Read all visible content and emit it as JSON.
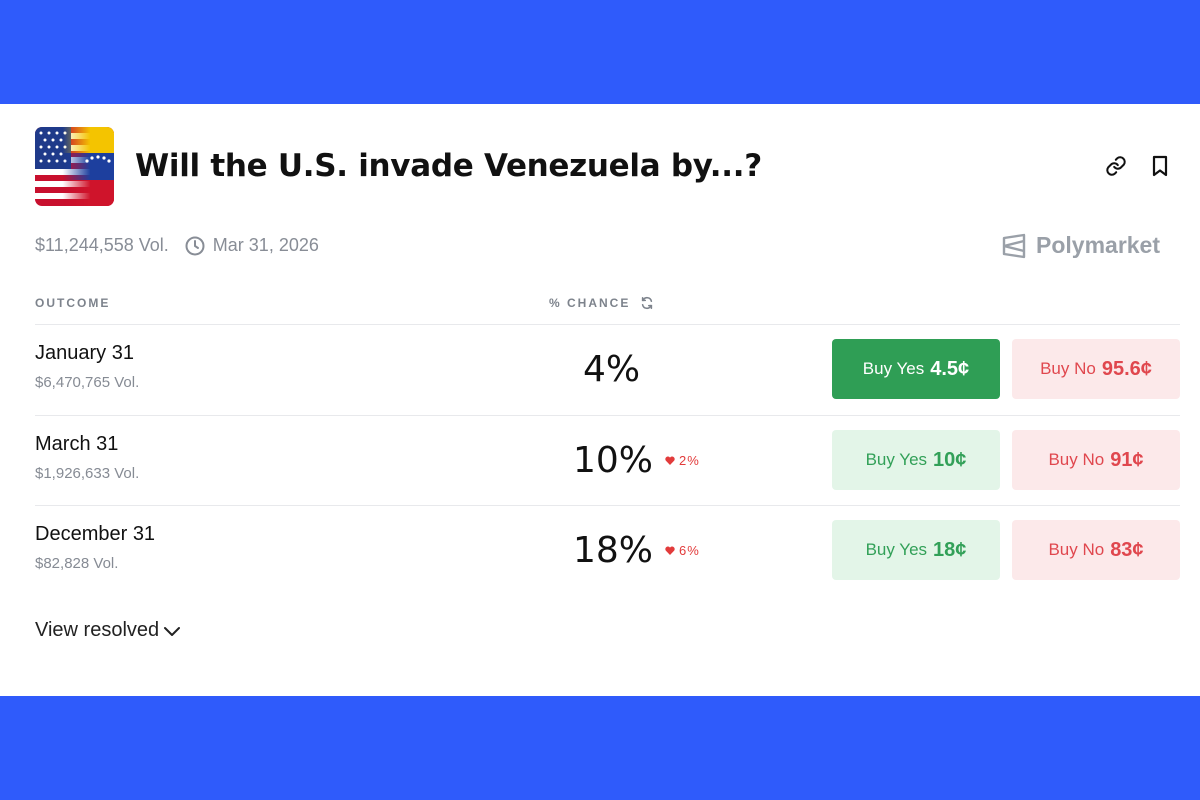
{
  "market": {
    "title": "Will the U.S. invade Venezuela by...?",
    "volume": "$11,244,558 Vol.",
    "end_date": "Mar 31, 2026",
    "brand": "Polymarket"
  },
  "columns": {
    "outcome": "OUTCOME",
    "chance": "% CHANCE"
  },
  "outcomes": [
    {
      "name": "January 31",
      "volume": "$6,470,765 Vol.",
      "chance": "4%",
      "change": "",
      "yes_label": "Buy Yes",
      "yes_price": "4.5¢",
      "no_label": "Buy No",
      "no_price": "95.6¢"
    },
    {
      "name": "March 31",
      "volume": "$1,926,633 Vol.",
      "chance": "10%",
      "change": "2%",
      "yes_label": "Buy Yes",
      "yes_price": "10¢",
      "no_label": "Buy No",
      "no_price": "91¢"
    },
    {
      "name": "December 31",
      "volume": "$82,828 Vol.",
      "chance": "18%",
      "change": "6%",
      "yes_label": "Buy Yes",
      "yes_price": "18¢",
      "no_label": "Buy No",
      "no_price": "83¢"
    }
  ],
  "view_resolved": "View resolved",
  "colors": {
    "background": "#2f5bfb",
    "yes_solid": "#2f9e55",
    "yes_light": "#e3f5e8",
    "no_light": "#fce9ea",
    "no_text": "#e0474e"
  },
  "icons": [
    "link-icon",
    "bookmark-icon",
    "clock-icon",
    "polymarket-logo-icon",
    "refresh-icon",
    "heart-down-icon",
    "chevron-down-icon"
  ]
}
